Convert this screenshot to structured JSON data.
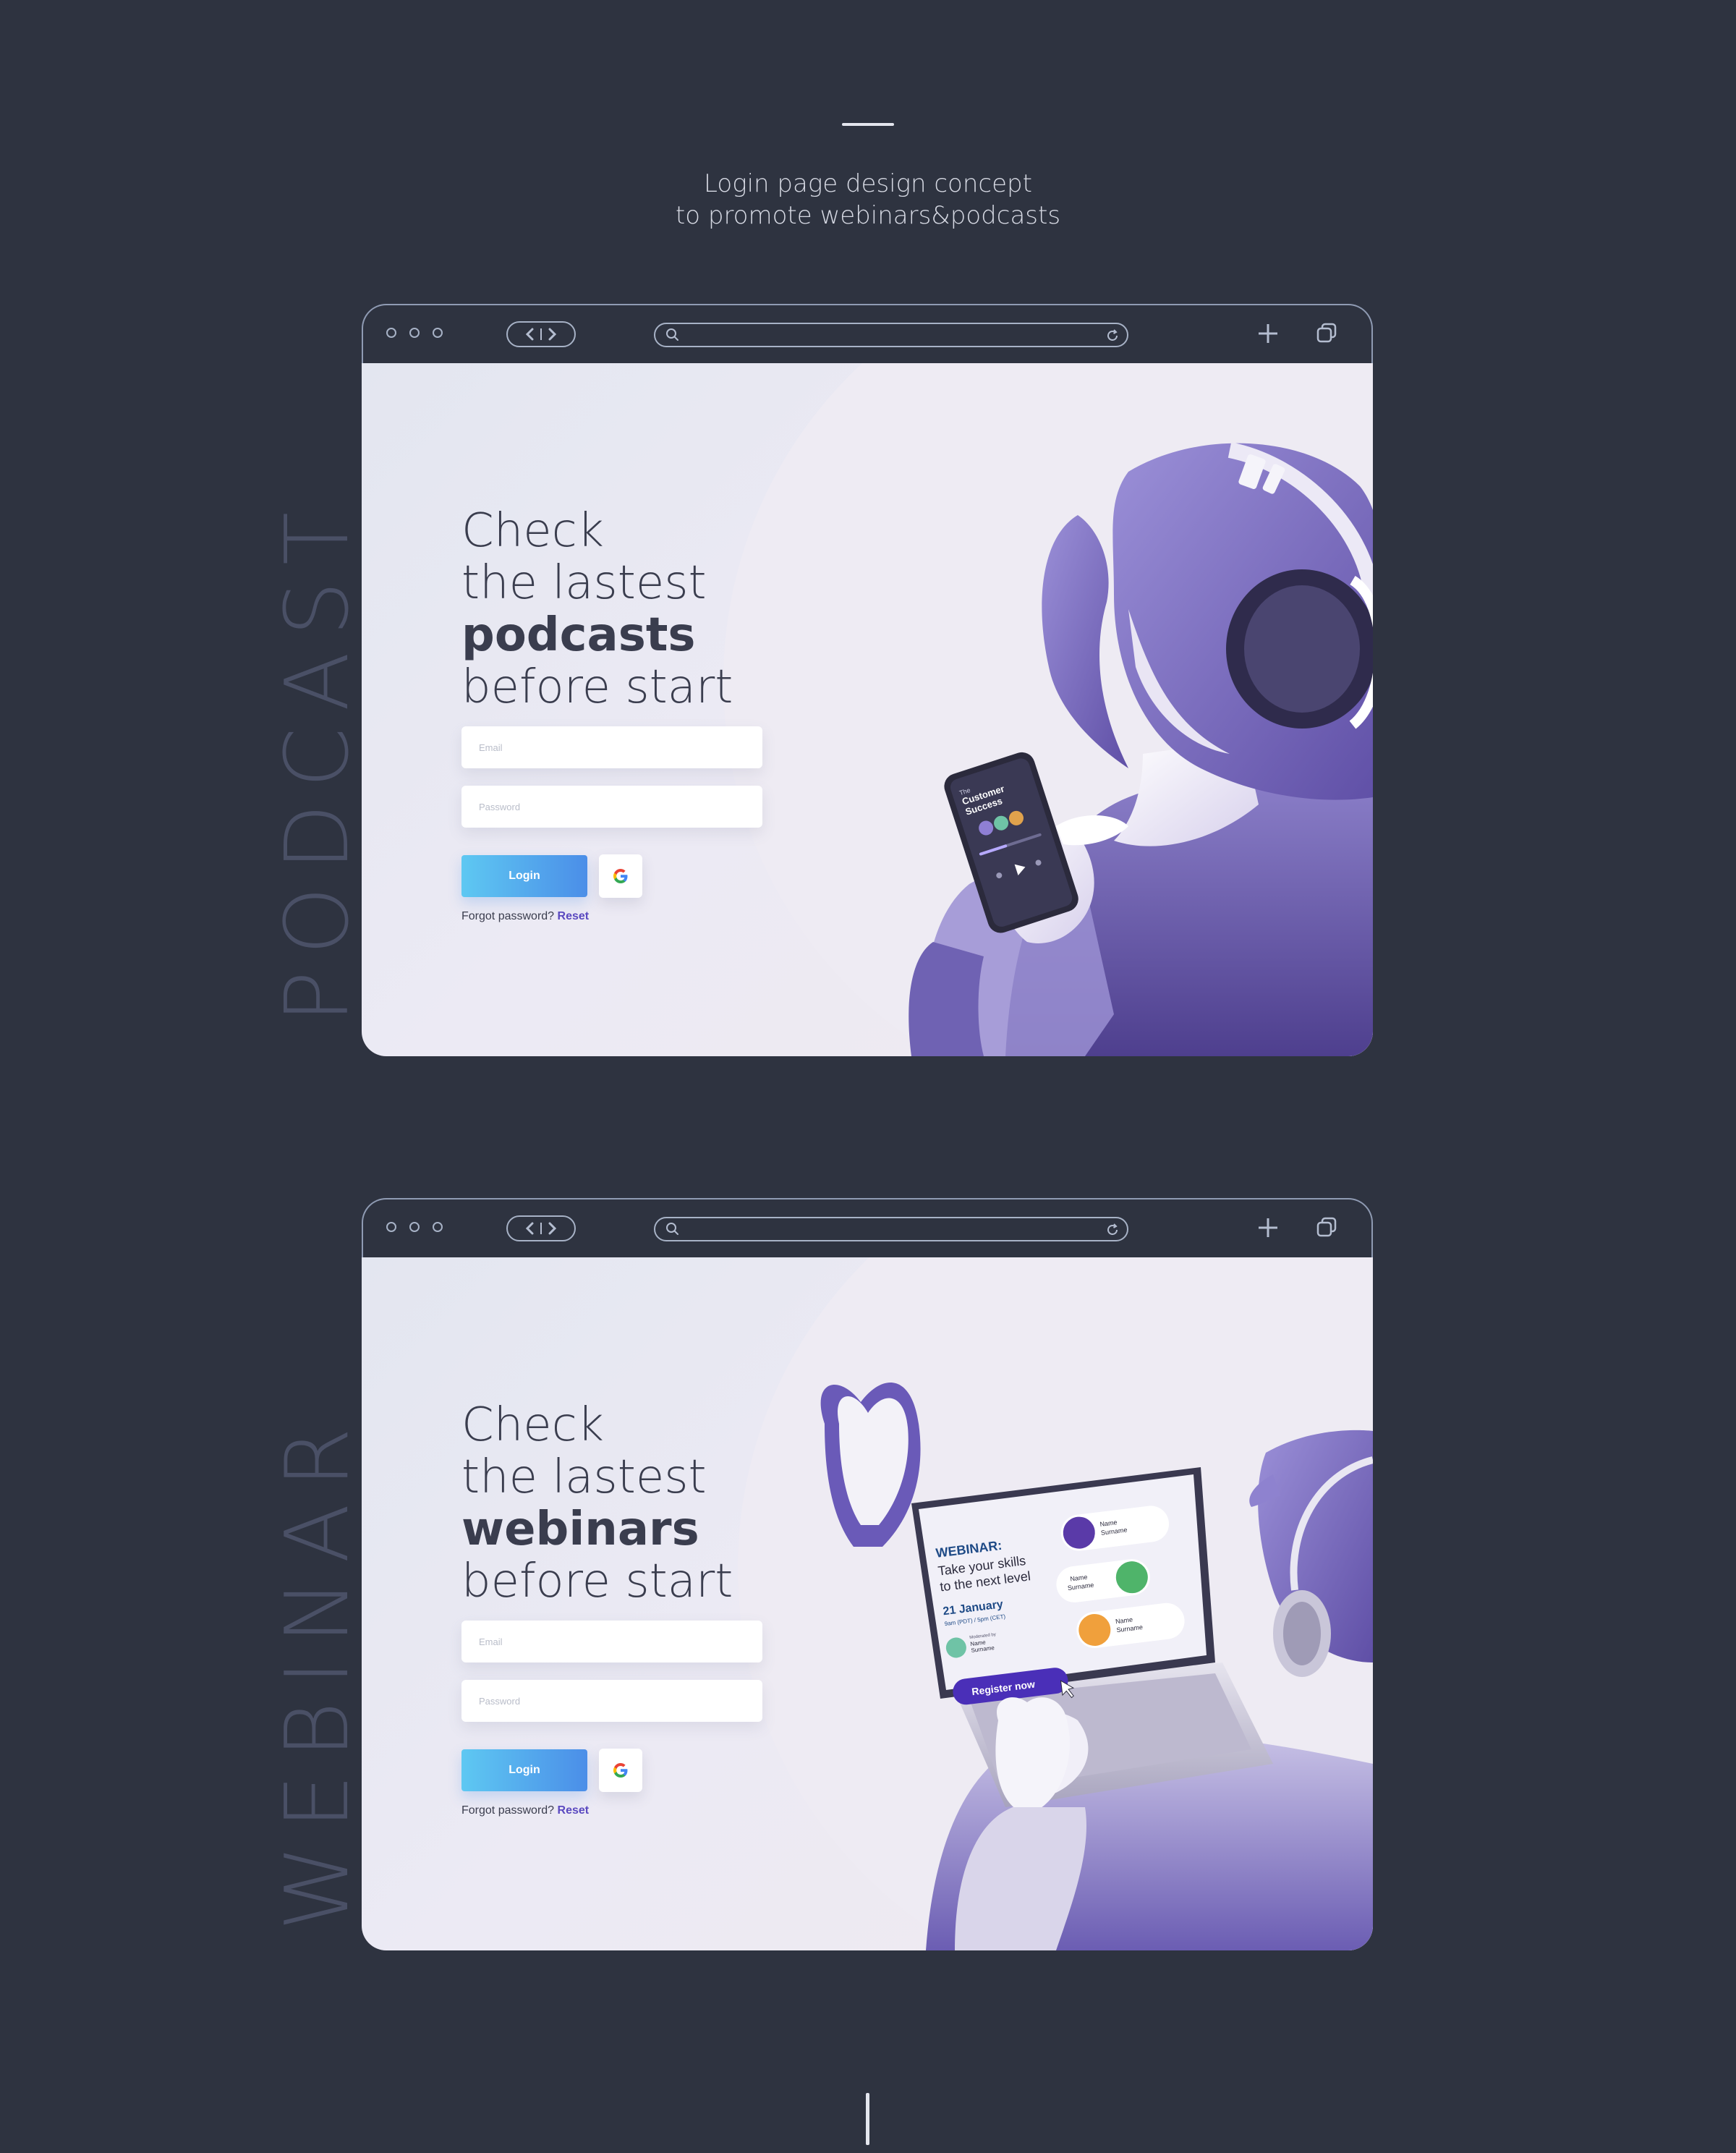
{
  "header": {
    "concept_line1": "Login page design concept",
    "concept_line2": "to promote webinars&podcasts"
  },
  "colors": {
    "background": "#2e3340",
    "accent_purple": "#6a5ab8",
    "login_gradient_start": "#5ec8f2",
    "login_gradient_end": "#4b8ee8",
    "reset_link": "#5a49c0"
  },
  "browser_icons": [
    "window-dot-icon",
    "back-icon",
    "forward-icon",
    "search-icon",
    "reload-icon",
    "new-tab-icon",
    "tabs-icon"
  ],
  "podcast": {
    "side_label": "PODCAST",
    "hero_line1": "Check",
    "hero_line2": "the lastest",
    "hero_bold": "podcasts",
    "hero_line4": "before start",
    "email_placeholder": "Email",
    "password_placeholder": "Password",
    "login_label": "Login",
    "google_icon": "google-icon",
    "forgot_text": "Forgot password?",
    "reset_label": "Reset",
    "phone": {
      "line1": "The",
      "line2": "Customer",
      "line3": "Success"
    }
  },
  "webinar": {
    "side_label": "WEBINAR",
    "hero_line1": "Check",
    "hero_line2": "the lastest",
    "hero_bold": "webinars",
    "hero_line4": "before start",
    "email_placeholder": "Email",
    "password_placeholder": "Password",
    "login_label": "Login",
    "google_icon": "google-icon",
    "forgot_text": "Forgot password?",
    "reset_label": "Reset",
    "laptop": {
      "title": "WEBINAR:",
      "subtitle1": "Take your skills",
      "subtitle2": "to the next level",
      "date": "21 January",
      "time": "9am (PDT) / 5pm (CET)",
      "moderated_by": "Moderated by",
      "moderator_name": "Name",
      "moderator_surname": "Surname",
      "register_label": "Register now",
      "speakers": [
        {
          "name": "Name",
          "surname": "Surname"
        },
        {
          "name": "Name",
          "surname": "Surname"
        },
        {
          "name": "Name",
          "surname": "Surname"
        }
      ]
    }
  }
}
